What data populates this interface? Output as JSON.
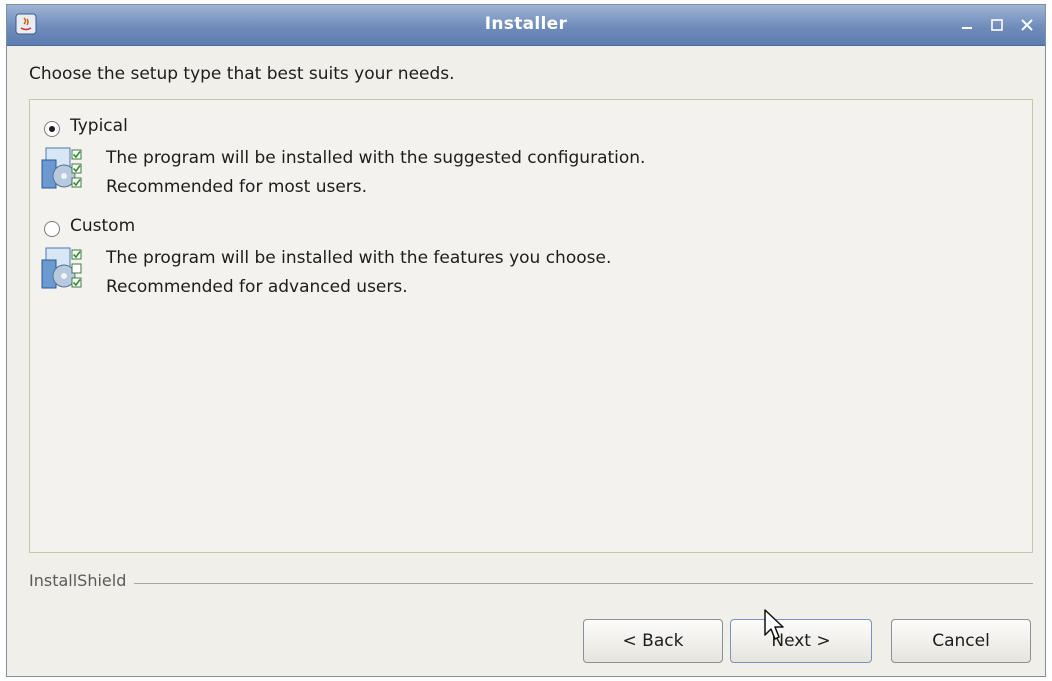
{
  "window": {
    "title": "Installer"
  },
  "heading": "Choose the setup type that best suits your needs.",
  "options": [
    {
      "label": "Typical",
      "selected": true,
      "description": [
        "The program will be installed with the suggested configuration.",
        "Recommended for most users."
      ],
      "icon": "install-typical-icon"
    },
    {
      "label": "Custom",
      "selected": false,
      "description": [
        "The program will be installed with the features you choose.",
        "Recommended for advanced users."
      ],
      "icon": "install-custom-icon"
    }
  ],
  "footer": {
    "brand": "InstallShield"
  },
  "buttons": {
    "back": "< Back",
    "next": "Next >",
    "cancel": "Cancel"
  },
  "colors": {
    "titlebar": "#6f8cbb",
    "window_bg": "#f0efe9",
    "panel_border": "#cbc4a7"
  }
}
